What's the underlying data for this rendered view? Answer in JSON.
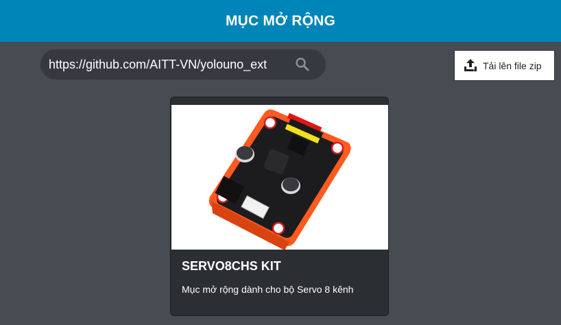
{
  "header": {
    "title": "MỤC MỞ RỘNG"
  },
  "search": {
    "value": "https://github.com/AITT-VN/yolouno_ext",
    "icon": "search-icon"
  },
  "upload": {
    "label": "Tải lên file zip",
    "icon": "upload-icon"
  },
  "extensions": [
    {
      "title": "SERVO8CHS KIT",
      "description": "Mục mở rộng dành cho bộ Servo 8 kênh"
    }
  ],
  "colors": {
    "header_bg": "#0085b8",
    "page_bg": "#474b52",
    "card_bg": "#2b2e33",
    "board_orange": "#ff5a1f"
  }
}
